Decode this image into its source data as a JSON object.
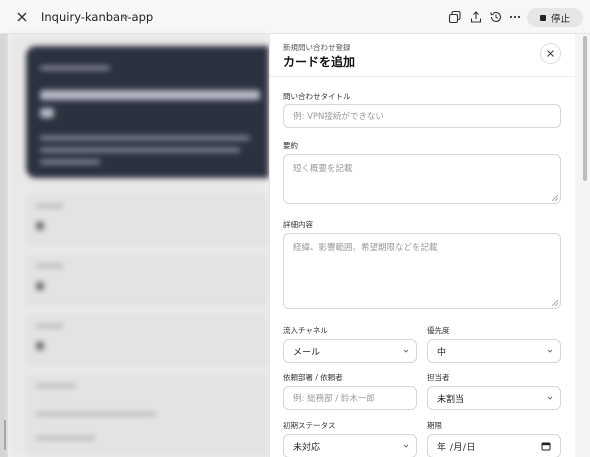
{
  "window": {
    "title": "Inquiry-kanban-app",
    "stop_label": "停止"
  },
  "panel": {
    "subtitle": "新規問い合わせ登録",
    "title": "カードを追加",
    "fields": {
      "title_label": "問い合わせタイトル",
      "title_placeholder": "例: VPN接続ができない",
      "summary_label": "要約",
      "summary_placeholder": "短く概要を記載",
      "details_label": "詳細内容",
      "details_placeholder": "経緯、影響範囲、希望期限などを記載",
      "channel_label": "流入チャネル",
      "channel_value": "メール",
      "priority_label": "優先度",
      "priority_value": "中",
      "requester_label": "依頼部署 / 依頼者",
      "requester_placeholder": "例: 総務部 / 鈴木一郎",
      "assignee_label": "担当者",
      "assignee_value": "未割当",
      "status_label": "初期ステータス",
      "status_value": "未対応",
      "due_label": "期限",
      "due_value": "年 /月/日"
    }
  },
  "icons": [
    "close-icon",
    "chevron-down-icon",
    "copy-icon",
    "share-icon",
    "history-icon",
    "more-icon",
    "stop-icon",
    "calendar-icon"
  ]
}
